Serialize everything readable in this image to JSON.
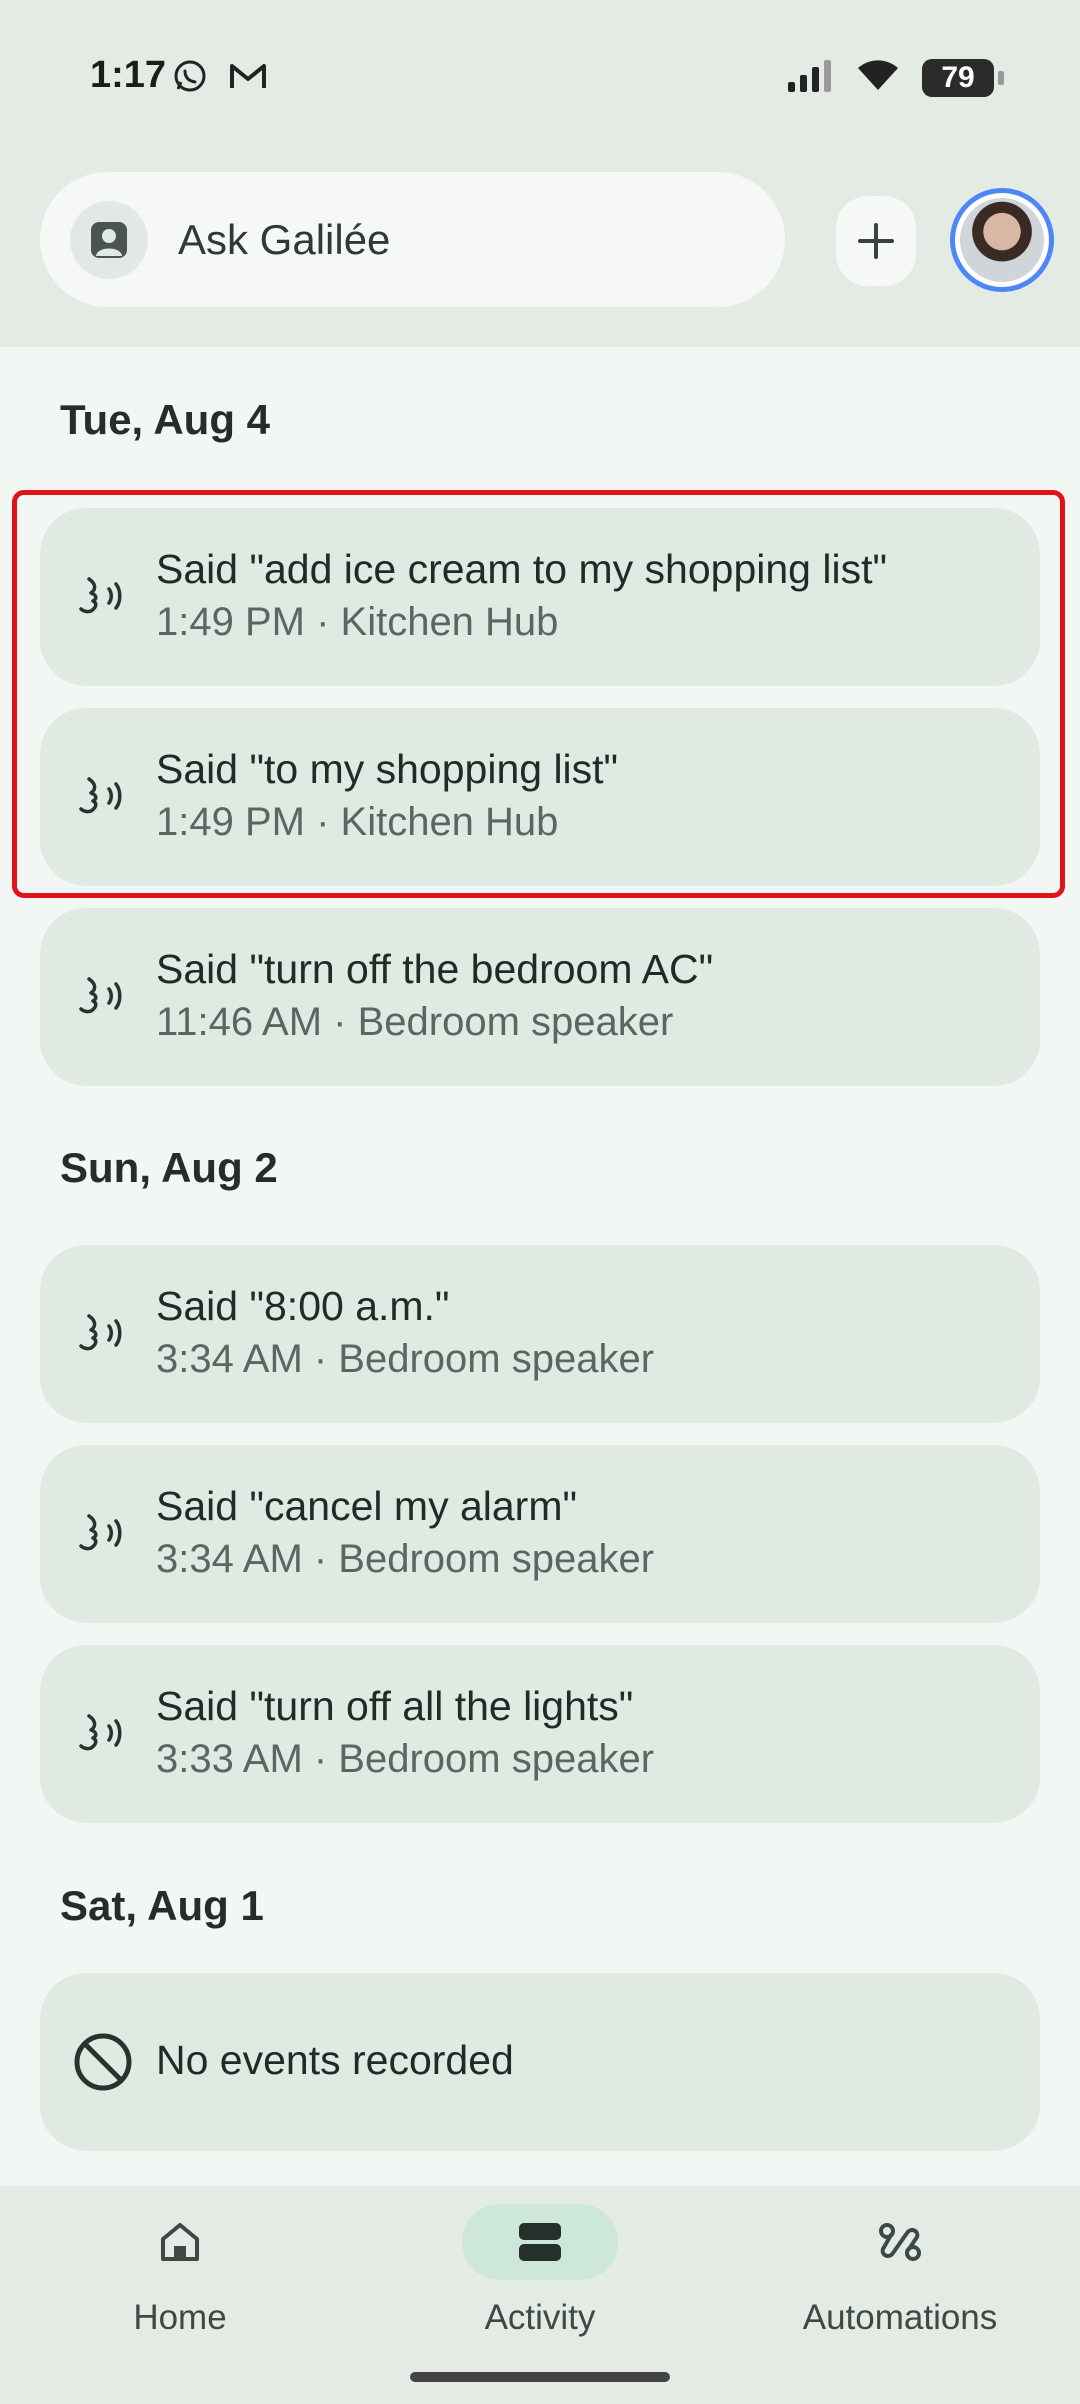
{
  "status_bar": {
    "time": "1:17",
    "battery": "79",
    "left_icons": [
      "whatsapp-icon",
      "gmail-icon"
    ],
    "right_icons": [
      "signal-icon",
      "wifi-icon",
      "battery-icon"
    ]
  },
  "header": {
    "search_label": "Ask Galilée",
    "add_button_label": "+"
  },
  "sections": [
    {
      "date": "Tue, Aug 4",
      "items": [
        {
          "title": "Said \"add ice cream to my shopping list\"",
          "sub": "1:49 PM · Kitchen Hub"
        },
        {
          "title": "Said \"to my shopping list\"",
          "sub": "1:49 PM · Kitchen Hub"
        },
        {
          "title": "Said \"turn off the bedroom AC\"",
          "sub": "11:46 AM · Bedroom speaker"
        }
      ]
    },
    {
      "date": "Sun, Aug 2",
      "items": [
        {
          "title": "Said \"8:00 a.m.\"",
          "sub": "3:34 AM · Bedroom speaker"
        },
        {
          "title": "Said \"cancel my alarm\"",
          "sub": "3:34 AM · Bedroom speaker"
        },
        {
          "title": "Said \"turn off all the lights\"",
          "sub": "3:33 AM · Bedroom speaker"
        }
      ]
    },
    {
      "date": "Sat, Aug 1",
      "items": [
        {
          "title": "No events recorded"
        }
      ]
    }
  ],
  "bottom_nav": {
    "items": [
      {
        "label": "Home",
        "icon": "home-icon"
      },
      {
        "label": "Activity",
        "icon": "activity-icon",
        "active": true
      },
      {
        "label": "Automations",
        "icon": "automations-icon"
      }
    ]
  },
  "colors": {
    "highlight_border": "#e0121a",
    "active_pill": "#cde8da",
    "card_bg": "#e1e9e3",
    "profile_ring": "#4f86f7"
  }
}
